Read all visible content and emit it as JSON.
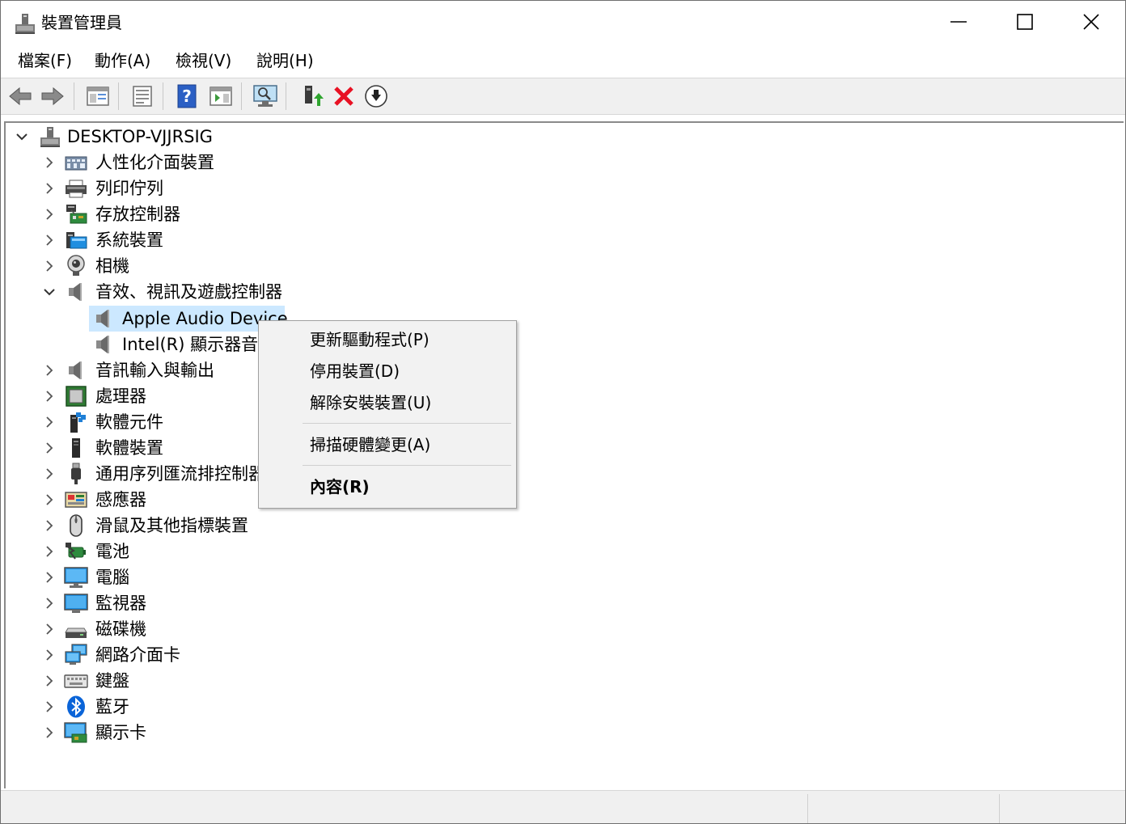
{
  "window": {
    "title": "裝置管理員"
  },
  "menu": [
    "檔案(F)",
    "動作(A)",
    "檢視(V)",
    "說明(H)"
  ],
  "toolbar": [
    {
      "name": "back-button",
      "icon": "back-arrow-icon"
    },
    {
      "name": "forward-button",
      "icon": "forward-arrow-icon"
    },
    {
      "name": "show-hide-console-tree-button",
      "icon": "console-tree-icon"
    },
    {
      "name": "properties-button",
      "icon": "properties-icon"
    },
    {
      "name": "help-button",
      "icon": "help-icon"
    },
    {
      "name": "action-pane-button",
      "icon": "action-pane-icon"
    },
    {
      "name": "scan-hardware-button",
      "icon": "scan-monitor-icon"
    },
    {
      "name": "update-driver-button",
      "icon": "update-driver-icon"
    },
    {
      "name": "uninstall-device-button",
      "icon": "red-x-icon"
    },
    {
      "name": "disable-device-button",
      "icon": "download-circle-icon"
    }
  ],
  "tree": {
    "root": "DESKTOP-VJJRSIG",
    "categories": [
      {
        "label": "人性化介面裝置",
        "icon": "hid-icon"
      },
      {
        "label": "列印佇列",
        "icon": "printer-icon"
      },
      {
        "label": "存放控制器",
        "icon": "storage-controller-icon"
      },
      {
        "label": "系統裝置",
        "icon": "system-devices-icon"
      },
      {
        "label": "相機",
        "icon": "camera-icon"
      },
      {
        "label": "音效、視訊及遊戲控制器",
        "icon": "speaker-icon",
        "expanded": true,
        "children": [
          {
            "label": "Apple Audio Device",
            "icon": "speaker-icon",
            "selected": true
          },
          {
            "label": "Intel(R) 顯示器音效",
            "icon": "speaker-icon"
          }
        ]
      },
      {
        "label": "音訊輸入與輸出",
        "icon": "speaker-icon"
      },
      {
        "label": "處理器",
        "icon": "processor-icon"
      },
      {
        "label": "軟體元件",
        "icon": "software-component-icon"
      },
      {
        "label": "軟體裝置",
        "icon": "software-device-icon"
      },
      {
        "label": "通用序列匯流排控制器",
        "icon": "usb-icon"
      },
      {
        "label": "感應器",
        "icon": "sensor-icon"
      },
      {
        "label": "滑鼠及其他指標裝置",
        "icon": "mouse-icon"
      },
      {
        "label": "電池",
        "icon": "battery-icon"
      },
      {
        "label": "電腦",
        "icon": "computer-icon"
      },
      {
        "label": "監視器",
        "icon": "monitor-icon"
      },
      {
        "label": "磁碟機",
        "icon": "disk-drive-icon"
      },
      {
        "label": "網路介面卡",
        "icon": "network-adapter-icon"
      },
      {
        "label": "鍵盤",
        "icon": "keyboard-icon"
      },
      {
        "label": "藍牙",
        "icon": "bluetooth-icon"
      },
      {
        "label": "顯示卡",
        "icon": "display-adapter-icon"
      }
    ]
  },
  "context_menu": {
    "items": [
      {
        "label": "更新驅動程式(P)",
        "name": "update-driver-menu-item"
      },
      {
        "label": "停用裝置(D)",
        "name": "disable-device-menu-item"
      },
      {
        "label": "解除安裝裝置(U)",
        "name": "uninstall-device-menu-item"
      },
      {
        "label": "掃描硬體變更(A)",
        "name": "scan-hardware-menu-item"
      },
      {
        "label": "內容(R)",
        "name": "properties-menu-item",
        "bold": true
      }
    ]
  },
  "colors": {
    "selection": "#cce8ff",
    "toolbar_bg": "#f0f0f0",
    "menu_bg": "#f2f2f2",
    "uninstall_red": "#e81123",
    "bluetooth_blue": "#0a64d8"
  }
}
